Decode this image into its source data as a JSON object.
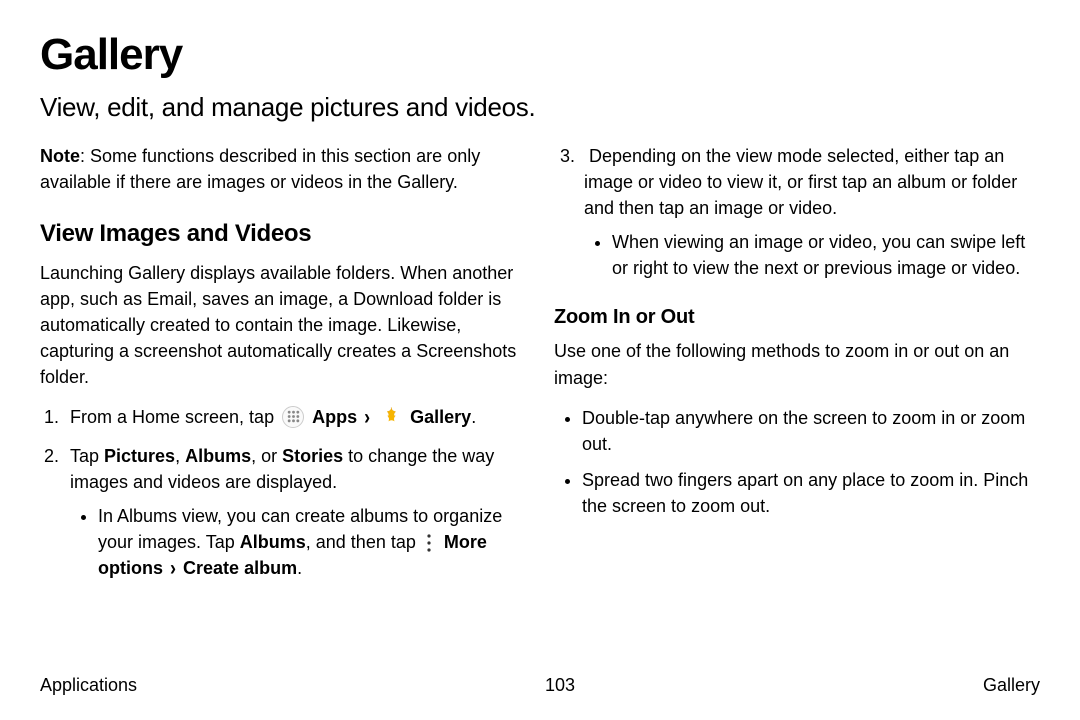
{
  "title": "Gallery",
  "subtitle": "View, edit, and manage pictures and videos.",
  "note_label": "Note",
  "note_text": ": Some functions described in this section are only available if there are images or videos in the Gallery.",
  "h2_view": "View Images and Videos",
  "view_para": "Launching Gallery displays available folders. When another app, such as Email, saves an image, a Download folder is automatically created to contain the image. Likewise, capturing a screenshot automatically creates a Screenshots folder.",
  "step1_a": "From a Home screen, tap ",
  "step1_apps": "Apps",
  "step1_arrow": "›",
  "step1_gallery": "Gallery",
  "step1_end": ".",
  "step2_a": "Tap ",
  "step2_pictures": "Pictures",
  "step2_c1": ", ",
  "step2_albums": "Albums",
  "step2_c2": ", or ",
  "step2_stories": "Stories",
  "step2_b": " to change the way images and videos are displayed.",
  "step2_sub_a": "In Albums view, you can create albums to organize your images. Tap ",
  "step2_sub_albums": "Albums",
  "step2_sub_b": ", and then tap ",
  "step2_sub_more": "More options",
  "step2_sub_arrow": "›",
  "step2_sub_create": "Create album",
  "step2_sub_end": ".",
  "step3": "Depending on the view mode selected, either tap an image or video to view it, or first tap an album or folder and then tap an image or video.",
  "step3_sub": "When viewing an image or video, you can swipe left or right to view the next or previous image or video.",
  "h3_zoom": "Zoom In or Out",
  "zoom_para": "Use one of the following methods to zoom in or out on an image:",
  "zoom_b1": "Double-tap anywhere on the screen to zoom in or zoom out.",
  "zoom_b2": "Spread two fingers apart on any place to zoom in. Pinch the screen to zoom out.",
  "footer_left": "Applications",
  "footer_page": "103",
  "footer_right": "Gallery"
}
